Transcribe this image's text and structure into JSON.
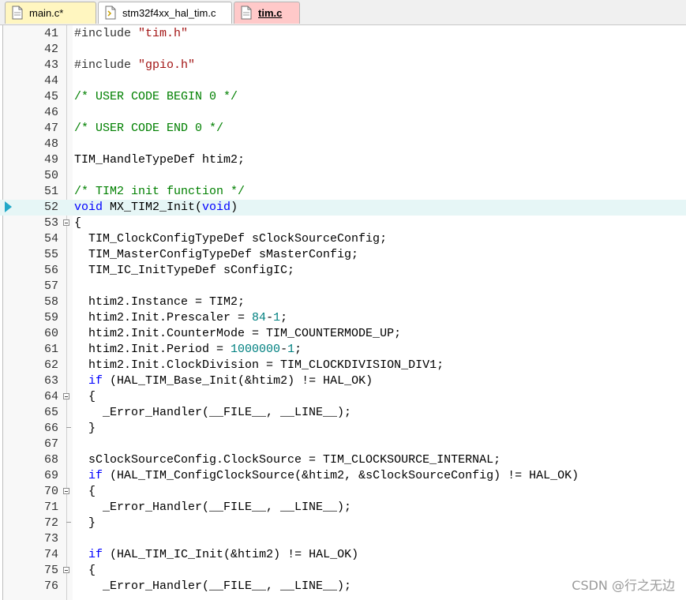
{
  "tabs": [
    {
      "label": "main.c*",
      "icon": "c-file-icon",
      "active": false
    },
    {
      "label": "stm32f4xx_hal_tim.c",
      "icon": "c-file-icon",
      "active": false
    },
    {
      "label": "tim.c",
      "icon": "c-file-icon",
      "active": true
    }
  ],
  "current_line": 52,
  "lines": [
    {
      "n": 41,
      "tokens": [
        {
          "t": "#include ",
          "c": "pp"
        },
        {
          "t": "\"tim.h\"",
          "c": "str"
        }
      ]
    },
    {
      "n": 42,
      "tokens": []
    },
    {
      "n": 43,
      "tokens": [
        {
          "t": "#include ",
          "c": "pp"
        },
        {
          "t": "\"gpio.h\"",
          "c": "str"
        }
      ]
    },
    {
      "n": 44,
      "tokens": []
    },
    {
      "n": 45,
      "tokens": [
        {
          "t": "/* USER CODE BEGIN 0 */",
          "c": "com"
        }
      ]
    },
    {
      "n": 46,
      "tokens": []
    },
    {
      "n": 47,
      "tokens": [
        {
          "t": "/* USER CODE END 0 */",
          "c": "com"
        }
      ]
    },
    {
      "n": 48,
      "tokens": []
    },
    {
      "n": 49,
      "tokens": [
        {
          "t": "TIM_HandleTypeDef htim2;",
          "c": ""
        }
      ]
    },
    {
      "n": 50,
      "tokens": []
    },
    {
      "n": 51,
      "tokens": [
        {
          "t": "/* TIM2 init function */",
          "c": "com"
        }
      ]
    },
    {
      "n": 52,
      "tokens": [
        {
          "t": "void",
          "c": "kw"
        },
        {
          "t": " MX_TIM2_Init(",
          "c": ""
        },
        {
          "t": "void",
          "c": "kw"
        },
        {
          "t": ")",
          "c": ""
        }
      ]
    },
    {
      "n": 53,
      "fold": "start",
      "tokens": [
        {
          "t": "{",
          "c": ""
        }
      ]
    },
    {
      "n": 54,
      "tokens": [
        {
          "t": "  TIM_ClockConfigTypeDef sClockSourceConfig;",
          "c": ""
        }
      ]
    },
    {
      "n": 55,
      "tokens": [
        {
          "t": "  TIM_MasterConfigTypeDef sMasterConfig;",
          "c": ""
        }
      ]
    },
    {
      "n": 56,
      "tokens": [
        {
          "t": "  TIM_IC_InitTypeDef sConfigIC;",
          "c": ""
        }
      ]
    },
    {
      "n": 57,
      "tokens": []
    },
    {
      "n": 58,
      "tokens": [
        {
          "t": "  htim2.Instance = TIM2;",
          "c": ""
        }
      ]
    },
    {
      "n": 59,
      "tokens": [
        {
          "t": "  htim2.Init.Prescaler = ",
          "c": ""
        },
        {
          "t": "84",
          "c": "num"
        },
        {
          "t": "-",
          "c": ""
        },
        {
          "t": "1",
          "c": "num"
        },
        {
          "t": ";",
          "c": ""
        }
      ]
    },
    {
      "n": 60,
      "tokens": [
        {
          "t": "  htim2.Init.CounterMode = TIM_COUNTERMODE_UP;",
          "c": ""
        }
      ]
    },
    {
      "n": 61,
      "tokens": [
        {
          "t": "  htim2.Init.Period = ",
          "c": ""
        },
        {
          "t": "1000000",
          "c": "num"
        },
        {
          "t": "-",
          "c": ""
        },
        {
          "t": "1",
          "c": "num"
        },
        {
          "t": ";",
          "c": ""
        }
      ]
    },
    {
      "n": 62,
      "tokens": [
        {
          "t": "  htim2.Init.ClockDivision = TIM_CLOCKDIVISION_DIV1;",
          "c": ""
        }
      ]
    },
    {
      "n": 63,
      "tokens": [
        {
          "t": "  ",
          "c": ""
        },
        {
          "t": "if",
          "c": "kw"
        },
        {
          "t": " (HAL_TIM_Base_Init(&htim2) != HAL_OK)",
          "c": ""
        }
      ]
    },
    {
      "n": 64,
      "fold": "start",
      "tokens": [
        {
          "t": "  {",
          "c": ""
        }
      ]
    },
    {
      "n": 65,
      "tokens": [
        {
          "t": "    _Error_Handler(__FILE__, __LINE__);",
          "c": ""
        }
      ]
    },
    {
      "n": 66,
      "fold": "end",
      "tokens": [
        {
          "t": "  }",
          "c": ""
        }
      ]
    },
    {
      "n": 67,
      "tokens": []
    },
    {
      "n": 68,
      "tokens": [
        {
          "t": "  sClockSourceConfig.ClockSource = TIM_CLOCKSOURCE_INTERNAL;",
          "c": ""
        }
      ]
    },
    {
      "n": 69,
      "tokens": [
        {
          "t": "  ",
          "c": ""
        },
        {
          "t": "if",
          "c": "kw"
        },
        {
          "t": " (HAL_TIM_ConfigClockSource(&htim2, &sClockSourceConfig) != HAL_OK)",
          "c": ""
        }
      ]
    },
    {
      "n": 70,
      "fold": "start",
      "tokens": [
        {
          "t": "  {",
          "c": ""
        }
      ]
    },
    {
      "n": 71,
      "tokens": [
        {
          "t": "    _Error_Handler(__FILE__, __LINE__);",
          "c": ""
        }
      ]
    },
    {
      "n": 72,
      "fold": "end",
      "tokens": [
        {
          "t": "  }",
          "c": ""
        }
      ]
    },
    {
      "n": 73,
      "tokens": []
    },
    {
      "n": 74,
      "tokens": [
        {
          "t": "  ",
          "c": ""
        },
        {
          "t": "if",
          "c": "kw"
        },
        {
          "t": " (HAL_TIM_IC_Init(&htim2) != HAL_OK)",
          "c": ""
        }
      ]
    },
    {
      "n": 75,
      "fold": "start",
      "tokens": [
        {
          "t": "  {",
          "c": ""
        }
      ]
    },
    {
      "n": 76,
      "tokens": [
        {
          "t": "    _Error_Handler(__FILE__, __LINE__);",
          "c": ""
        }
      ]
    }
  ],
  "watermark": "CSDN @行之无边",
  "colors": {
    "keyword": "#0000ff",
    "comment": "#008000",
    "string": "#a31515",
    "number": "#008080",
    "current_line_bg": "#e6f6f6"
  }
}
